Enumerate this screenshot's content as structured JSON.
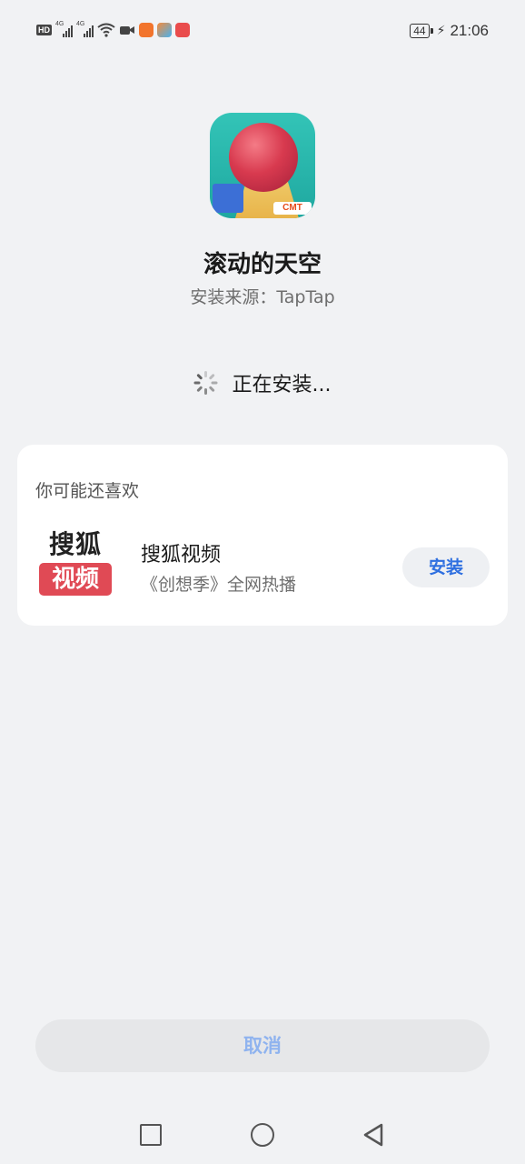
{
  "status_bar": {
    "hd_label": "HD",
    "net1": "4G",
    "net2": "4G",
    "battery": "44",
    "time": "21:06",
    "app_icon_colors": [
      "#f2742c",
      "#f58b3a",
      "#e94c4c"
    ]
  },
  "app": {
    "name": "滚动的天空",
    "source": "安装来源：TapTap",
    "icon_logo_text": "CMT"
  },
  "progress": {
    "status": "正在安装..."
  },
  "recommendations": {
    "title": "你可能还喜欢",
    "items": [
      {
        "icon_text_top": "搜狐",
        "icon_text_bottom": "视频",
        "name": "搜狐视频",
        "description": "《创想季》全网热播",
        "install_label": "安装"
      }
    ]
  },
  "actions": {
    "cancel_label": "取消"
  },
  "colors": {
    "background": "#f1f2f4",
    "accent": "#2e6fe0",
    "cancel_text": "#8fb3ef",
    "sohu_red": "#e04a55"
  }
}
